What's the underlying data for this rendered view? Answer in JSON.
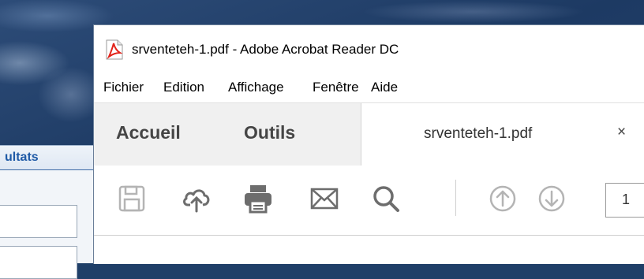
{
  "background_app": {
    "tab_label": "ultats"
  },
  "window": {
    "title": "srventeteh-1.pdf - Adobe Acrobat Reader DC",
    "app_icon": "acrobat-reader-icon"
  },
  "menu": {
    "items": [
      {
        "label": "Fichier"
      },
      {
        "label": "Edition"
      },
      {
        "label": "Affichage"
      },
      {
        "label": "Fenêtre"
      },
      {
        "label": "Aide"
      }
    ]
  },
  "tabs": {
    "home": "Accueil",
    "tools": "Outils",
    "document": "srventeteh-1.pdf",
    "close_glyph": "×"
  },
  "toolbar": {
    "icons": [
      "save-icon",
      "cloud-upload-icon",
      "print-icon",
      "email-icon",
      "search-icon",
      "arrow-up-circle-icon",
      "arrow-down-circle-icon"
    ],
    "page_number": "1"
  },
  "colors": {
    "acrobat_red": "#e2231a",
    "icon_gray": "#6d6d6d",
    "icon_disabled": "#b4b4b4",
    "tab_bg": "#f0f0f0"
  }
}
